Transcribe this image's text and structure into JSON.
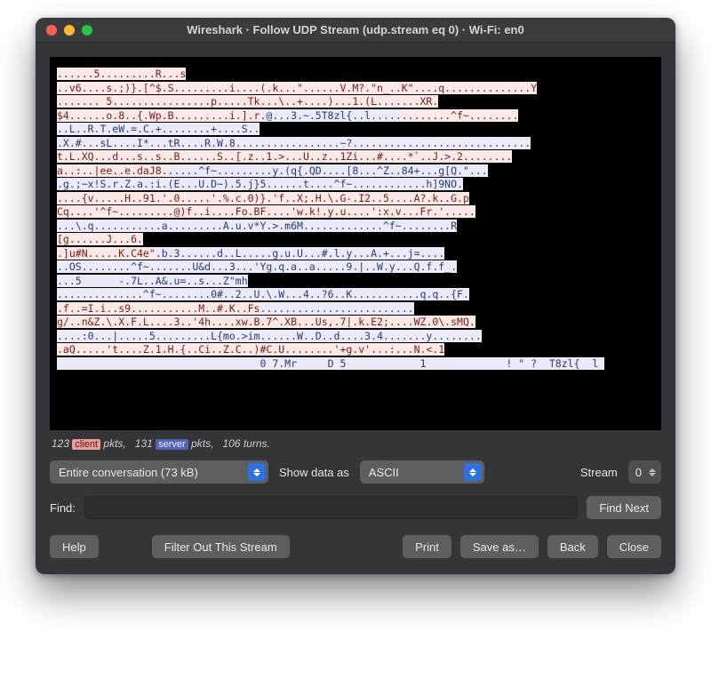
{
  "window": {
    "title": "Wireshark · Follow UDP Stream (udp.stream eq 0) · Wi-Fi: en0"
  },
  "stream": {
    "segments": [
      {
        "t": "cl",
        "s": "......5.........R...s"
      },
      {
        "t": "bk",
        "s": "                                                                                  "
      },
      {
        "t": "cl",
        "s": "\n..v6....s.;)}.[^$.S.........i....(.k...\"......V.M?.\"n_..K\"....q..............Y\n....... 5................p.....Tk...\\..+....)...1.(L.......XR."
      },
      {
        "t": "bk",
        "s": "                   "
      },
      {
        "t": "cl",
        "s": "\n$4......o.8..{.Wp.B.........i.].r"
      },
      {
        "t": "sv",
        "s": ".@...3.~.5T8zl{..l....."
      },
      {
        "t": "cl",
        "s": "........^f~........\n"
      },
      {
        "t": "sv",
        "s": "..L..R.T.eW.=.C.+........+....S.."
      },
      {
        "t": "bk",
        "s": "                                                     "
      },
      {
        "t": "sv",
        "s": "\n.X.#...sL....I*...tR....R.W.8.................~?.............................\n"
      },
      {
        "t": "cl",
        "s": "t.L.XQ...d...s..s..B......S..[.z..1.>...U..z..1Zi...#....*`..J.>.2........\na..:..|ee..e.daJ8."
      },
      {
        "t": "sv",
        "s": ".....^f~.........y.(q{.QD....[8...^Z..84+...g[Q.\"...\n.g.;~x!S.r.Z.a.:i.(E...U.D~).5.j}5......t....^f~............h]9NO.\n"
      },
      {
        "t": "cl",
        "s": "....{v.....H..91.'.0.....'.%.c.0)}.'f..X;.H.\\.G-.I2..5....A?.k..G.p"
      },
      {
        "t": "bk",
        "s": "     "
      },
      {
        "t": "cl",
        "s": "\nCq....'^f~.........@)f..i....Fo.BF....'w.k!.y.u....':x.v...Fr.'.....\n"
      },
      {
        "t": "sv",
        "s": "...\\.q...........a.........A.u.v*Y.>.m6M.............^f~........R\n"
      },
      {
        "t": "cl",
        "s": "[g......J...6."
      },
      {
        "t": "bk",
        "s": "                                                                          "
      },
      {
        "t": "cl",
        "s": "\n.]u#N.....K.C4e\""
      },
      {
        "t": "sv",
        "s": ".b.3......d..L.....g.u.U...#.l.y...A.+...j=....\n..OS........^f~.......U&d...3...'Yg.q.a..a.....9.|..W.y...Q.f.f_.\n...5      -.7L..A&.u=..s...Z\"mh"
      },
      {
        "t": "bk",
        "s": "                                                         "
      },
      {
        "t": "sv",
        "s": "\n..............^f~........0#..2..U.\\.W...4..?6..K...........q.q..{F."
      },
      {
        "t": "cl",
        "s": "\n.f..=I.i..s9...........M..#.K..Fs"
      },
      {
        "t": "sv",
        "s": "........................."
      },
      {
        "t": "bk",
        "s": "                            "
      },
      {
        "t": "cl",
        "s": "\ng/..n&Z.\\.X.F.L....3..'4h....xw.B.7^.XB...Us,.7|.k.E2;....WZ.0\\.sMQ.\n"
      },
      {
        "t": "sv",
        "s": "....:0...|.....5.........L{mo.>im......W..D..d....3.4.......y........\n"
      },
      {
        "t": "cl",
        "s": ".aQ.....'t....Z.1.H.{..Ci..Z.C..)#C.U........'+g.v'...:...N.<.1\n"
      },
      {
        "t": "sv",
        "s": "                                 0 7.Mr     D 5            1             ! \" ?  T8zl{  l "
      }
    ]
  },
  "status": {
    "client_pkts": 123,
    "server_pkts": 131,
    "turns": 106,
    "client_label": "client",
    "server_label": "server",
    "prefix": " pkts,",
    "suffix_pkts": " pkts,",
    "suffix_turns": " turns."
  },
  "controls": {
    "conversation_select": "Entire conversation (73 kB)",
    "show_as_label": "Show data as",
    "show_as_select": "ASCII",
    "stream_label": "Stream",
    "stream_value": "0"
  },
  "find": {
    "label": "Find:",
    "value": "",
    "next_button": "Find Next"
  },
  "buttons": {
    "help": "Help",
    "filter": "Filter Out This Stream",
    "print": "Print",
    "saveas": "Save as…",
    "back": "Back",
    "close": "Close"
  }
}
